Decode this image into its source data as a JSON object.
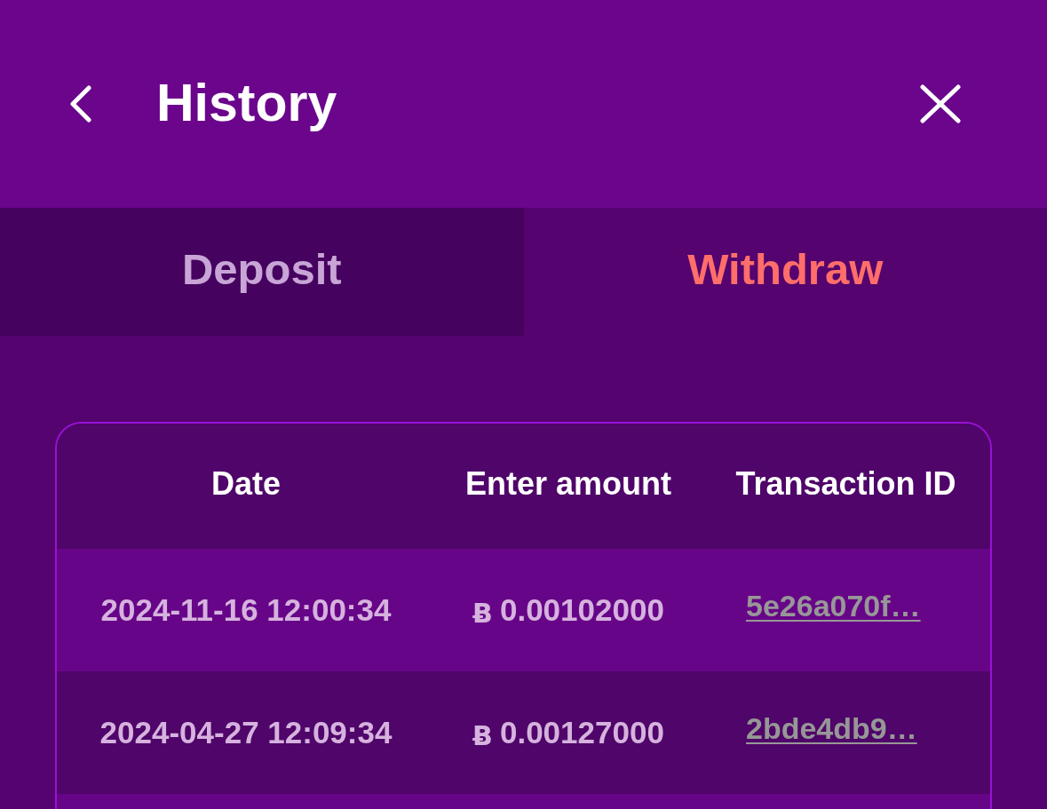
{
  "header": {
    "title": "History"
  },
  "tabs": [
    {
      "label": "Deposit",
      "selected": false
    },
    {
      "label": "Withdraw",
      "selected": true
    }
  ],
  "table": {
    "columns": [
      "Date",
      "Enter amount",
      "Transaction ID"
    ],
    "rows": [
      {
        "date": "2024-11-16 12:00:34",
        "currency_symbol": "Ƀ",
        "amount": "0.00102000",
        "transaction_id": "5e26a070f…"
      },
      {
        "date": "2024-04-27 12:09:34",
        "currency_symbol": "Ƀ",
        "amount": "0.00127000",
        "transaction_id": "2bde4db9…"
      }
    ]
  }
}
